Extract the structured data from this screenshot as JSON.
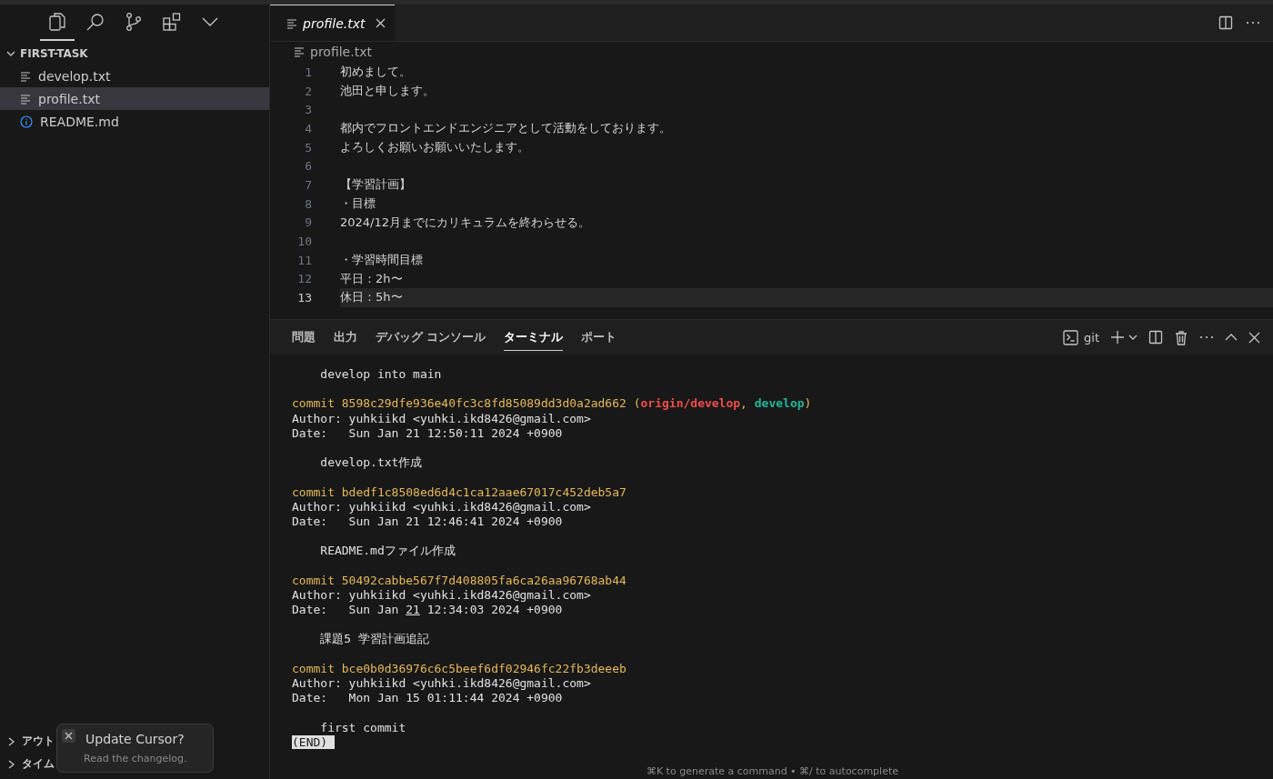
{
  "activity_bar": [
    {
      "kind": "files",
      "selected": true
    },
    {
      "kind": "search",
      "selected": false
    },
    {
      "kind": "source-control",
      "selected": false
    },
    {
      "kind": "extensions",
      "selected": false
    },
    {
      "kind": "more",
      "selected": false
    }
  ],
  "explorer": {
    "folder": "FIRST-TASK",
    "expanded": true,
    "items": [
      {
        "name": "develop.txt",
        "kind": "text",
        "selected": false
      },
      {
        "name": "profile.txt",
        "kind": "text",
        "selected": true
      },
      {
        "name": "README.md",
        "kind": "info",
        "selected": false
      }
    ],
    "sections": [
      {
        "title": "アウト",
        "expanded": false
      },
      {
        "title": "タイム",
        "expanded": false
      }
    ]
  },
  "toast": {
    "title": "Update Cursor?",
    "message": "Read the changelog."
  },
  "editor": {
    "tab": {
      "label": "profile.txt",
      "preview": true
    },
    "breadcrumb": "profile.txt",
    "lines": [
      {
        "number": "1",
        "text": "初めまして。",
        "current": false
      },
      {
        "number": "2",
        "text": "池田と申します。",
        "current": false
      },
      {
        "number": "3",
        "current": false
      },
      {
        "number": "4",
        "text": "都内でフロントエンドエンジニアとして活動をしております。",
        "current": false
      },
      {
        "number": "5",
        "text": "よろしくお願いお願いいたします。",
        "current": false
      },
      {
        "number": "6",
        "current": false
      },
      {
        "number": "7",
        "text": "【学習計画】",
        "current": false
      },
      {
        "number": "8",
        "text": "・目標",
        "current": false
      },
      {
        "number": "9",
        "text": "2024/12月までにカリキュラムを終わらせる。",
        "current": false
      },
      {
        "number": "10",
        "current": false
      },
      {
        "number": "11",
        "text": "・学習時間目標",
        "current": false
      },
      {
        "number": "12",
        "text": "平日：2h〜",
        "current": false
      },
      {
        "number": "13",
        "text": "休日：5h〜",
        "current": true
      }
    ]
  },
  "panel": {
    "tabs": [
      {
        "label": "問題",
        "selected": false
      },
      {
        "label": "出力",
        "selected": false
      },
      {
        "label": "デバッグ コンソール",
        "selected": false
      },
      {
        "label": "ターミナル",
        "selected": true
      },
      {
        "label": "ポート",
        "selected": false
      }
    ],
    "terminal_name": "git",
    "lines": [
      {
        "kind": "text",
        "text": "    develop into main"
      },
      {
        "kind": "blank"
      },
      {
        "kind": "commit",
        "color": "#e5b95c",
        "segments": [
          {
            "text": "commit 8598c29dfe936e40fc3c8fd85089dd3d0a2ad662 (",
            "bold": false
          },
          {
            "text": "origin/develop",
            "color": "#f14c4c",
            "bold": true
          },
          {
            "text": ", ",
            "bold": false
          },
          {
            "text": "develop",
            "color": "#23b89a",
            "bold": true
          },
          {
            "text": ")",
            "bold": false
          }
        ]
      },
      {
        "kind": "text",
        "text": "Author: yuhkiikd <yuhki.ikd8426@gmail.com>"
      },
      {
        "kind": "text",
        "text": "Date:   Sun Jan 21 12:50:11 2024 +0900"
      },
      {
        "kind": "blank"
      },
      {
        "kind": "text",
        "text": "    develop.txt作成"
      },
      {
        "kind": "blank"
      },
      {
        "kind": "commit",
        "segments": [
          {
            "text": "commit bdedf1c8508ed6d4c1ca12aae67017c452deb5a7",
            "color": "#e5b95c",
            "bold": false
          }
        ]
      },
      {
        "kind": "text",
        "text": "Author: yuhkiikd <yuhki.ikd8426@gmail.com>"
      },
      {
        "kind": "text",
        "text": "Date:   Sun Jan 21 12:46:41 2024 +0900"
      },
      {
        "kind": "blank"
      },
      {
        "kind": "text",
        "text": "    README.mdファイル作成"
      },
      {
        "kind": "blank"
      },
      {
        "kind": "commit",
        "segments": [
          {
            "text": "commit 50492cabbe567f7d408805fa6ca26aa96768ab44",
            "color": "#e5b95c",
            "bold": false
          }
        ]
      },
      {
        "kind": "text",
        "text": "Author: yuhkiikd <yuhki.ikd8426@gmail.com>"
      },
      {
        "kind": "underlined",
        "segments": [
          {
            "text": "Date:   Sun Jan ",
            "underline": false
          },
          {
            "text": "21",
            "underline": true
          },
          {
            "text": " 12:34:03 2024 +0900",
            "underline": false
          }
        ]
      },
      {
        "kind": "blank"
      },
      {
        "kind": "text",
        "text": "    課題5 学習計画追記"
      },
      {
        "kind": "blank"
      },
      {
        "kind": "commit",
        "segments": [
          {
            "text": "commit bce0b0d36976c6c5beef6df02946fc22fb3deeeb",
            "color": "#e5b95c",
            "bold": false
          }
        ]
      },
      {
        "kind": "text",
        "text": "Author: yuhkiikd <yuhki.ikd8426@gmail.com>"
      },
      {
        "kind": "text",
        "text": "Date:   Mon Jan 15 01:11:44 2024 +0900"
      },
      {
        "kind": "blank"
      },
      {
        "kind": "text",
        "text": "    first commit"
      },
      {
        "kind": "end",
        "text": "(END)"
      }
    ],
    "hint": "⌘K to generate a command • ⌘/ to autocomplete"
  }
}
